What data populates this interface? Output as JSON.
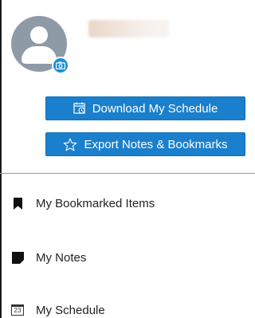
{
  "profile": {
    "avatar_icon": "user-avatar-icon",
    "camera_icon": "camera-icon"
  },
  "actions": {
    "download_schedule_label": "Download My Schedule",
    "download_schedule_icon": "calendar-clock-icon",
    "export_label": "Export Notes & Bookmarks",
    "export_icon": "star-outline-icon"
  },
  "menu": {
    "items": [
      {
        "label": "My Bookmarked Items",
        "icon": "bookmark-icon"
      },
      {
        "label": "My Notes",
        "icon": "note-icon"
      },
      {
        "label": "My Schedule",
        "icon": "calendar-icon",
        "icon_text": "23"
      }
    ]
  },
  "colors": {
    "accent": "#1a7fcc",
    "avatar_bg": "#8e9aa6",
    "badge": "#1f8ed6"
  }
}
